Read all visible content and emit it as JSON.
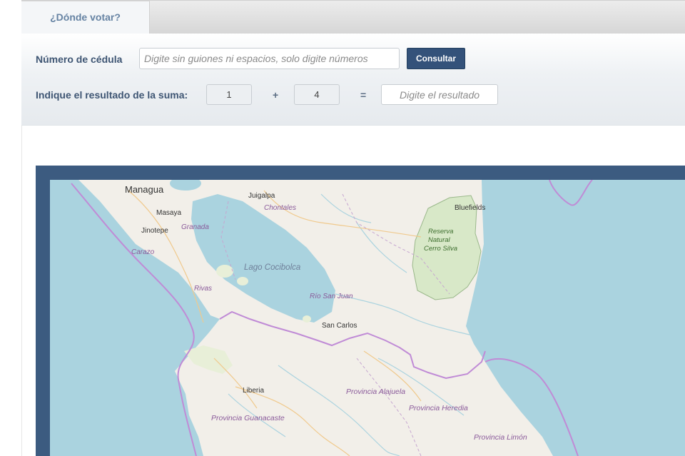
{
  "tab": {
    "label": "¿Dónde votar?"
  },
  "form": {
    "cedula_label": "Número de cédula",
    "cedula_placeholder": "Digite sin guiones ni espacios, solo digite números",
    "submit_label": "Consultar",
    "captcha_label": "Indique el resultado de la suma:",
    "operand_a": "1",
    "plus": "+",
    "operand_b": "4",
    "equals": "=",
    "result_placeholder": "Digite el resultado"
  },
  "map": {
    "labels": {
      "managua": "Managua",
      "juigalpa": "Juigalpa",
      "chontales": "Chontales",
      "bluefields": "Bluefields",
      "masaya": "Masaya",
      "jinotepe": "Jinotepe",
      "granada": "Granada",
      "carazo": "Carazo",
      "reserva1": "Reserva",
      "reserva2": "Natural",
      "reserva3": "Cerro Silva",
      "lago": "Lago Cocibolca",
      "rivas": "Rivas",
      "rio_san_juan": "Río San Juan",
      "san_carlos": "San Carlos",
      "liberia": "Liberia",
      "alajuela": "Provincia Alajuela",
      "heredia": "Provincia Heredia",
      "guanacaste": "Provincia Guanacaste",
      "limon": "Provincia Limón"
    },
    "colors": {
      "water": "#aad3df",
      "land": "#f2efe9",
      "border": "#c08bd6",
      "reserve": "#d8e8c8"
    }
  }
}
